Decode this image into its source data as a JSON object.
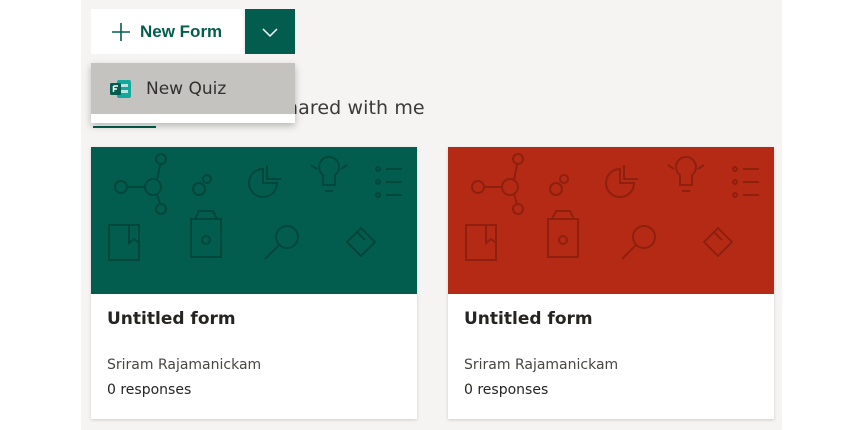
{
  "toolbar": {
    "new_form_label": "New Form",
    "accent_color": "#035d4f"
  },
  "menu": {
    "items": [
      {
        "label": "New Quiz",
        "icon": "forms-quiz-icon"
      }
    ]
  },
  "tabs": {
    "shared_label_visible": "hared with me"
  },
  "cards": [
    {
      "title": "Untitled form",
      "owner": "Sriram Rajamanickam",
      "responses": "0 responses",
      "theme_color": "#035d4f"
    },
    {
      "title": "Untitled form",
      "owner": "Sriram Rajamanickam",
      "responses": "0 responses",
      "theme_color": "#b52a15"
    }
  ]
}
